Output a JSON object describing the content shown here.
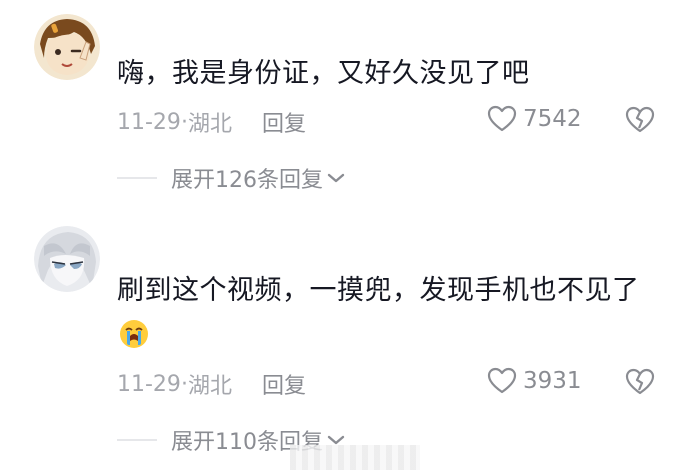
{
  "comments": [
    {
      "text": "嗨，我是身份证，又好久没见了吧",
      "date": "11-29",
      "location": "湖北",
      "reply_label": "回复",
      "likes": "7542",
      "expand_label": "展开126条回复",
      "avatar": "cartoon-girl-avatar"
    },
    {
      "text": "刷到这个视频，一摸兜，发现手机也不见了",
      "emoji": "crying-emoji",
      "date": "11-29",
      "location": "湖北",
      "reply_label": "回复",
      "likes": "3931",
      "expand_label": "展开110条回复",
      "avatar": "anime-character-avatar"
    }
  ],
  "separator": " · ",
  "colors": {
    "text": "#161823",
    "meta": "#a5a7ad",
    "action": "#8a8c92"
  }
}
